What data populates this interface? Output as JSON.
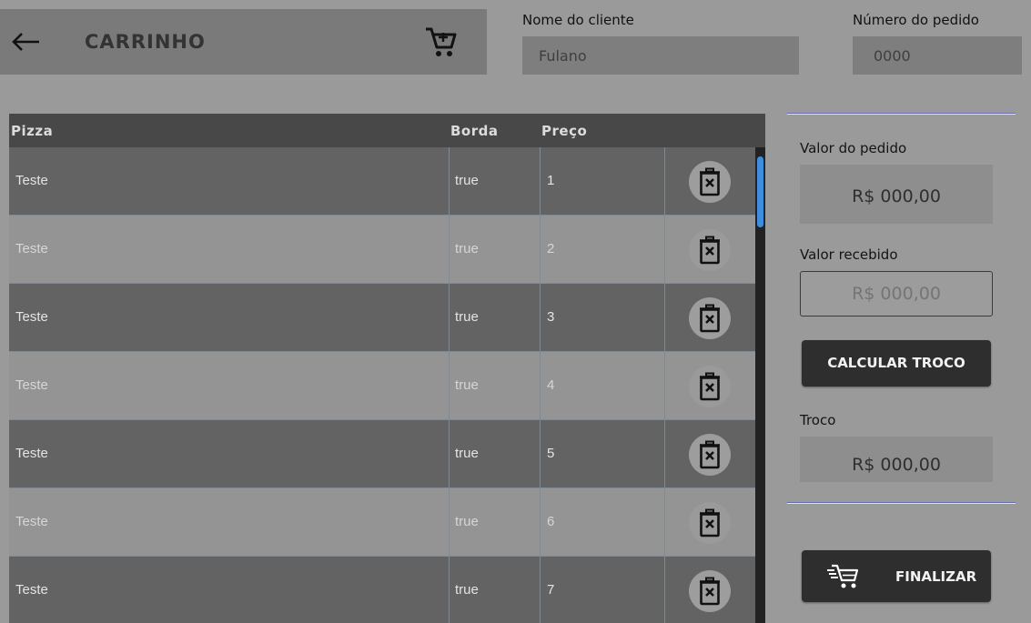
{
  "header": {
    "back_icon": "arrow-left-icon",
    "title": "CARRINHO",
    "cart_icon": "shopping-cart-icon"
  },
  "customer": {
    "label": "Nome do cliente",
    "placeholder": "Fulano"
  },
  "order_number": {
    "label": "Número do pedido",
    "placeholder": "0000"
  },
  "table": {
    "columns": [
      "Pizza",
      "Borda",
      "Preço"
    ],
    "rows": [
      {
        "pizza": "Teste",
        "borda": "true",
        "preco": "1"
      },
      {
        "pizza": "Teste",
        "borda": "true",
        "preco": "2"
      },
      {
        "pizza": "Teste",
        "borda": "true",
        "preco": "3"
      },
      {
        "pizza": "Teste",
        "borda": "true",
        "preco": "4"
      },
      {
        "pizza": "Teste",
        "borda": "true",
        "preco": "5"
      },
      {
        "pizza": "Teste",
        "borda": "true",
        "preco": "6"
      },
      {
        "pizza": "Teste",
        "borda": "true",
        "preco": "7"
      }
    ],
    "delete_icon": "trash-delete-icon",
    "scroll_accent": "#3d8ee0"
  },
  "summary": {
    "order_value_label": "Valor do pedido",
    "order_value": "R$ 000,00",
    "received_label": "Valor recebido",
    "received_placeholder": "R$ 000,00",
    "calc_button": "CALCULAR TROCO",
    "change_label": "Troco",
    "change_value": "R$ 000,00",
    "finalize_button": "FINALIZAR",
    "finalize_icon": "fast-cart-icon"
  }
}
